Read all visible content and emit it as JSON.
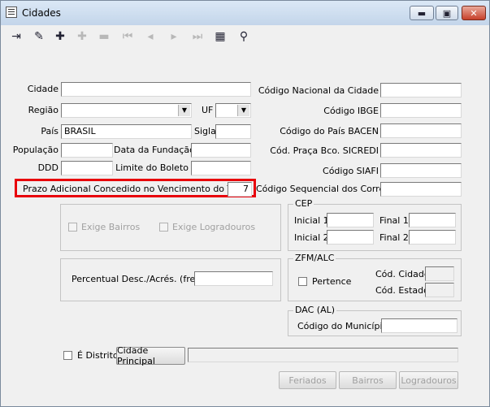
{
  "window": {
    "title": "Cidades",
    "min_glyph": "▬",
    "max_glyph": "▣",
    "close_glyph": "✕"
  },
  "toolbar": {
    "icons": [
      "exit-icon",
      "edit-icon",
      "insert-icon",
      "add-icon",
      "delete-icon",
      "first-icon",
      "prior-icon",
      "next-icon",
      "last-icon",
      "grid-icon",
      "search-icon"
    ],
    "glyphs": {
      "exit": "⇥",
      "edit": "✎",
      "insert": "✚",
      "add": "✚",
      "delete": "▬",
      "first": "⏮",
      "prior": "◂",
      "next": "▸",
      "last": "⏭",
      "grid": "▦",
      "search": "⚲"
    }
  },
  "form": {
    "cidade_label": "Cidade",
    "cidade_value": "",
    "regiao_label": "Região",
    "regiao_value": "",
    "uf_label": "UF",
    "uf_value": "",
    "pais_label": "País",
    "pais_value": "BRASIL",
    "sigla_label": "Sigla",
    "sigla_value": "",
    "populacao_label": "População",
    "populacao_value": "",
    "data_fundacao_label": "Data da Fundação",
    "data_fundacao_value": "",
    "ddd_label": "DDD",
    "ddd_value": "",
    "limite_boleto_label": "Limite do Boleto",
    "limite_boleto_value": "",
    "prazo_label": "Prazo Adicional Concedido no Vencimento do Título",
    "prazo_value": "7",
    "cod_nacional_label": "Código Nacional da Cidade",
    "cod_ibge_label": "Código IBGE",
    "cod_pais_bacen_label": "Código do País BACEN",
    "cod_praca_label": "Cód. Praça Bco. SICREDI",
    "cod_siafi_label": "Código SIAFI",
    "cod_seq_correios_label": "Código Sequencial dos Correios"
  },
  "exige": {
    "bairros_label": "Exige Bairros",
    "logradouros_label": "Exige Logradouros"
  },
  "cep": {
    "title": "CEP",
    "inicial1_label": "Inicial 1",
    "final1_label": "Final 1",
    "inicial2_label": "Inicial 2",
    "final2_label": "Final 2"
  },
  "percentual": {
    "label": "Percentual Desc./Acrés. (frete)",
    "value": ""
  },
  "zfm": {
    "title": "ZFM/ALC",
    "pertence_label": "Pertence",
    "cod_cidade_label": "Cód. Cidade",
    "cod_estado_label": "Cód. Estado"
  },
  "dac": {
    "title": "DAC (AL)",
    "cod_municipio_label": "Código do Município"
  },
  "distrito": {
    "label": "É Distrito",
    "cidade_principal_button": "Cidade Principal"
  },
  "buttons": {
    "feriados": "Feriados",
    "bairros": "Bairros",
    "logradouros": "Logradouros"
  }
}
